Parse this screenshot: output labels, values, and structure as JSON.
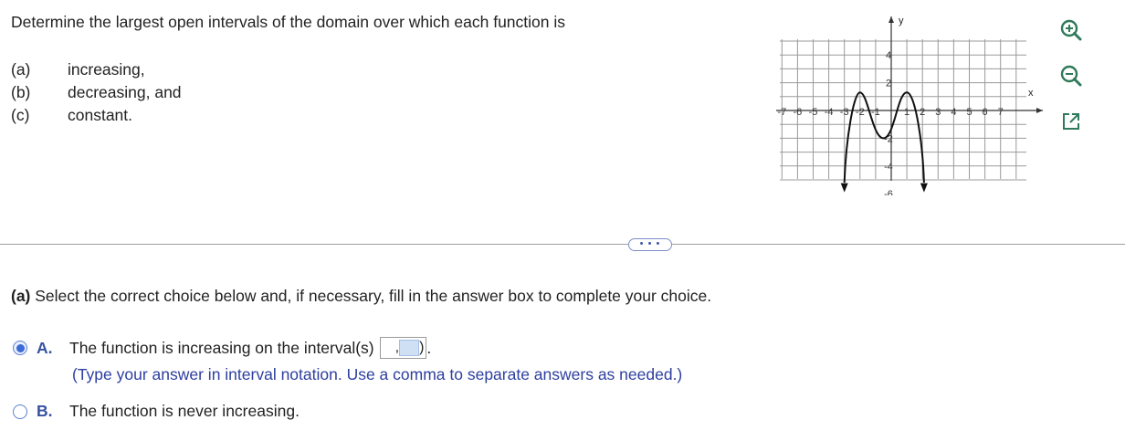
{
  "question": {
    "text": "Determine the largest open intervals of the domain over which each function is",
    "parts": [
      {
        "letter": "(a)",
        "text": "increasing,"
      },
      {
        "letter": "(b)",
        "text": "decreasing, and"
      },
      {
        "letter": "(c)",
        "text": "constant."
      }
    ]
  },
  "graph": {
    "axis_x_label": "x",
    "axis_y_label": "y",
    "x_ticks": [
      "-7",
      "-6",
      "-5",
      "-4",
      "-3",
      "-2",
      "-1",
      "1",
      "2",
      "3",
      "4",
      "5",
      "6",
      "7"
    ],
    "y_ticks": [
      "4",
      "2",
      "-2",
      "-4",
      "-6"
    ],
    "curve_color": "#111111",
    "grid_color": "#9a9a9a"
  },
  "tools": {
    "zoom_in_icon": "zoom-in-icon",
    "zoom_out_icon": "zoom-out-icon",
    "external_icon": "external-link-icon"
  },
  "more_button_label": "• • •",
  "part_a": {
    "prompt_bold": "(a)",
    "prompt": " Select the correct choice below and, if necessary, fill in the answer box to complete your choice.",
    "choices": [
      {
        "letter": "A.",
        "text": "The function is increasing on the interval(s)",
        "selected": true
      },
      {
        "letter": "B.",
        "text": "The function is never increasing.",
        "selected": false
      }
    ],
    "answer_sep": ",",
    "answer_close": ")",
    "answer_tail": ".",
    "hint": "(Type your answer in interval notation. Use a comma to separate answers as needed.)"
  },
  "colors": {
    "accent": "#3c6ad6",
    "hint_text": "#2d3f9e"
  }
}
